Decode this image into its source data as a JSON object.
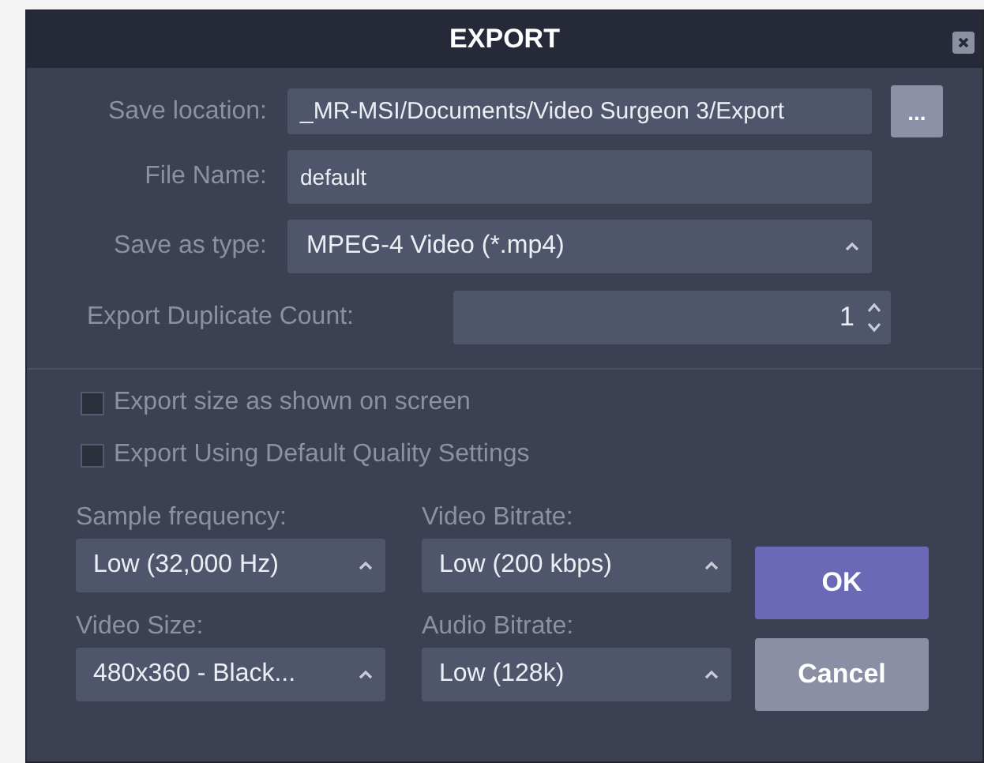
{
  "window": {
    "title": "EXPORT"
  },
  "fields": [
    {
      "kind": "path",
      "label": "Save location:",
      "value": "_MR-MSI/Documents/Video Surgeon 3/Export",
      "button": "..."
    },
    {
      "kind": "text",
      "label": "File Name:",
      "value": "default"
    },
    {
      "kind": "dropdown",
      "label": "Save as type:",
      "value": "MPEG-4 Video (*.mp4)"
    },
    {
      "kind": "spinner",
      "label": "Export Duplicate Count:",
      "value": "1"
    }
  ],
  "checkboxes": [
    {
      "label": "Export size as shown on screen",
      "checked": false
    },
    {
      "label": "Export Using Default Quality Settings",
      "checked": false
    }
  ],
  "settings": [
    {
      "label": "Sample frequency:",
      "value": "Low (32,000 Hz)"
    },
    {
      "label": "Video Bitrate:",
      "value": "Low (200 kbps)"
    },
    {
      "label": "Video Size:",
      "value": "480x360 - Black..."
    },
    {
      "label": "Audio Bitrate:",
      "value": "Low (128k)"
    }
  ],
  "buttons": [
    {
      "label": "OK",
      "kind": "primary"
    },
    {
      "label": "Cancel",
      "kind": "secondary"
    }
  ]
}
